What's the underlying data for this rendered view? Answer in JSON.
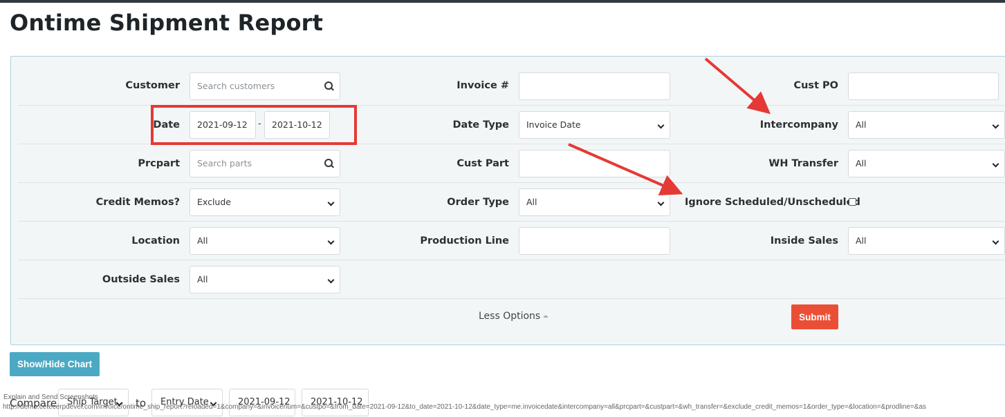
{
  "page": {
    "title": "Ontime Shipment Report"
  },
  "filters": {
    "customer": {
      "label": "Customer",
      "placeholder": "Search customers"
    },
    "invoice": {
      "label": "Invoice #",
      "value": ""
    },
    "cust_po": {
      "label": "Cust PO",
      "value": ""
    },
    "date": {
      "label": "Date",
      "from": "2021-09-12",
      "separator": "-",
      "to": "2021-10-12"
    },
    "date_type": {
      "label": "Date Type",
      "value": "Invoice Date"
    },
    "intercompany": {
      "label": "Intercompany",
      "value": "All"
    },
    "prcpart": {
      "label": "Prcpart",
      "placeholder": "Search parts"
    },
    "cust_part": {
      "label": "Cust Part",
      "value": ""
    },
    "wh_transfer": {
      "label": "WH Transfer",
      "value": "All"
    },
    "credit_memos": {
      "label": "Credit Memos?",
      "value": "Exclude"
    },
    "order_type": {
      "label": "Order Type",
      "value": "All"
    },
    "ignore_scheduled": {
      "label": "Ignore Scheduled/Unscheduled",
      "checked": false
    },
    "location": {
      "label": "Location",
      "value": "All"
    },
    "production_line": {
      "label": "Production Line",
      "value": ""
    },
    "inside_sales": {
      "label": "Inside Sales",
      "value": "All"
    },
    "outside_sales": {
      "label": "Outside Sales",
      "value": "All"
    }
  },
  "actions": {
    "less_options": "Less Options",
    "submit": "Submit",
    "show_hide_chart": "Show/Hide Chart"
  },
  "compare": {
    "label": "Compare",
    "metric": "Ship Target",
    "to_label": "to",
    "date_type": "Entry Date",
    "from": "2021-09-12",
    "to": "2021-10-12"
  },
  "overlay": {
    "tooltip": "Explain and Send Screenshots",
    "status_url": "http://demo.cetecerpdevel.com/invoice/ontime_ship_report?reloaded=1&company=&invoicenum=&custpo=&from_date=2021-09-12&to_date=2021-10-12&date_type=me.invoicedate&intercompany=all&prcpart=&custpart=&wh_transfer=&exclude_credit_memos=1&order_type=&location=&prodline=&as"
  },
  "colors": {
    "submit": "#ea4f35",
    "chart_button": "#4ba9c4",
    "panel_border": "#a9d2dc",
    "annotation_red": "#e53935"
  }
}
